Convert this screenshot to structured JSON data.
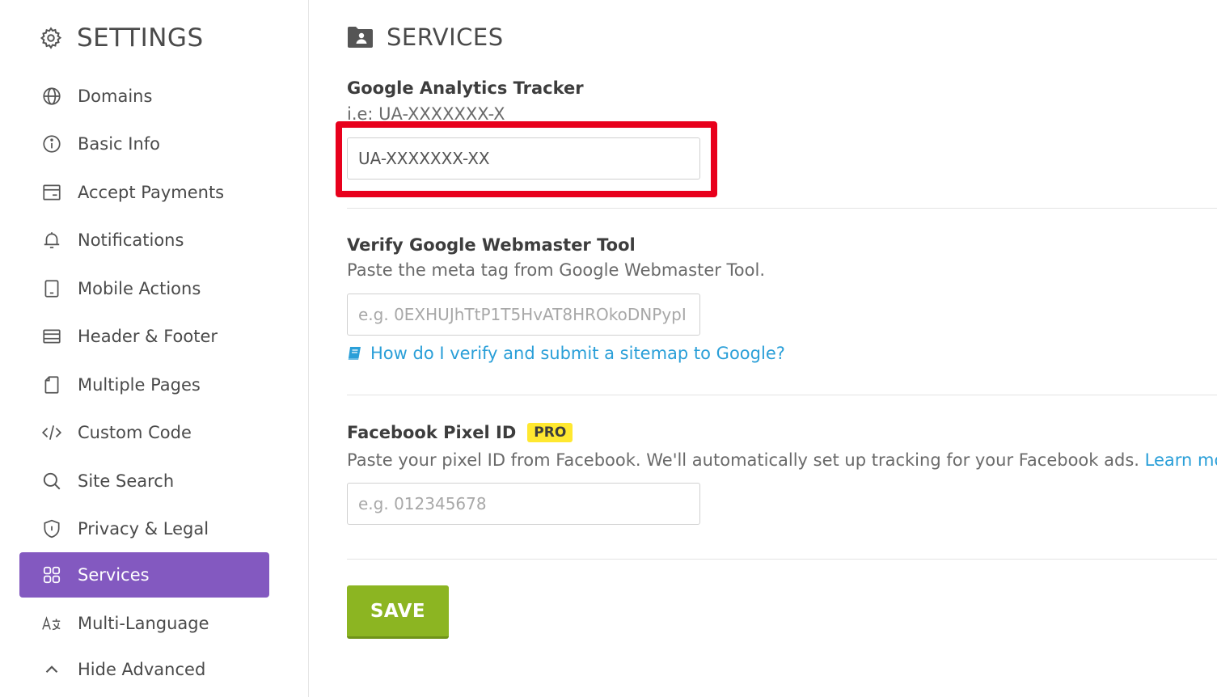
{
  "sidebar": {
    "title": "SETTINGS",
    "title_icon": "gear-icon",
    "items": [
      {
        "label": "Domains",
        "icon": "globe-icon"
      },
      {
        "label": "Basic Info",
        "icon": "info-icon"
      },
      {
        "label": "Accept Payments",
        "icon": "payment-card-icon"
      },
      {
        "label": "Notifications",
        "icon": "bell-icon"
      },
      {
        "label": "Mobile Actions",
        "icon": "mobile-icon"
      },
      {
        "label": "Header & Footer",
        "icon": "header-footer-icon"
      },
      {
        "label": "Multiple Pages",
        "icon": "pages-icon"
      },
      {
        "label": "Custom Code",
        "icon": "code-icon"
      },
      {
        "label": "Site Search",
        "icon": "search-icon"
      },
      {
        "label": "Privacy & Legal",
        "icon": "shield-icon"
      },
      {
        "label": "Services",
        "icon": "grid-icon",
        "active": true
      },
      {
        "label": "Multi-Language",
        "icon": "language-icon"
      },
      {
        "label": "Hide Advanced",
        "icon": "chevron-up-icon"
      }
    ]
  },
  "main": {
    "title": "SERVICES",
    "title_icon": "folder-user-icon",
    "google_analytics": {
      "label": "Google Analytics Tracker",
      "hint": "i.e: UA-XXXXXXX-X",
      "value": "UA-XXXXXXX-XX",
      "placeholder": ""
    },
    "webmaster": {
      "label": "Verify Google Webmaster Tool",
      "hint": "Paste the meta tag from Google Webmaster Tool.",
      "value": "",
      "placeholder": "e.g. 0EXHUJhTtP1T5HvAT8HROkoDNPypI",
      "help_link": "How do I verify and submit a sitemap to Google?",
      "help_icon": "book-icon"
    },
    "facebook_pixel": {
      "label": "Facebook Pixel ID",
      "badge": "PRO",
      "hint": "Paste your pixel ID from Facebook. We'll automatically set up tracking for your Facebook ads.",
      "learn_more": "Learn more.",
      "value": "",
      "placeholder": "e.g. 012345678"
    },
    "save_label": "SAVE"
  },
  "colors": {
    "accent": "#8359c0",
    "link": "#2a9fd8",
    "save": "#8cb522",
    "highlight": "#e8001c",
    "badge": "#ffe830"
  }
}
